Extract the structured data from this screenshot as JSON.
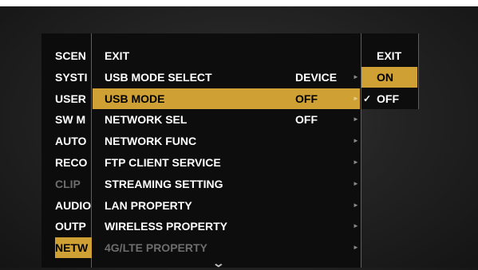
{
  "left_menu": [
    {
      "label": "SCEN",
      "selected": false,
      "disabled": false
    },
    {
      "label": "SYSTI",
      "selected": false,
      "disabled": false
    },
    {
      "label": "USER",
      "selected": false,
      "disabled": false
    },
    {
      "label": "SW M",
      "selected": false,
      "disabled": false
    },
    {
      "label": "AUTO",
      "selected": false,
      "disabled": false
    },
    {
      "label": "RECO",
      "selected": false,
      "disabled": false
    },
    {
      "label": "CLIP",
      "selected": false,
      "disabled": true
    },
    {
      "label": "AUDIO",
      "selected": false,
      "disabled": false
    },
    {
      "label": "OUTP",
      "selected": false,
      "disabled": false
    },
    {
      "label": "NETW",
      "selected": true,
      "disabled": false
    }
  ],
  "network_menu": [
    {
      "label": "EXIT",
      "value": "",
      "has_arrow": false,
      "selected": false,
      "disabled": false
    },
    {
      "label": "USB MODE SELECT",
      "value": "DEVICE",
      "has_arrow": true,
      "selected": false,
      "disabled": false
    },
    {
      "label": "USB MODE",
      "value": "OFF",
      "has_arrow": true,
      "selected": true,
      "disabled": false
    },
    {
      "label": "NETWORK SEL",
      "value": "OFF",
      "has_arrow": true,
      "selected": false,
      "disabled": false
    },
    {
      "label": "NETWORK FUNC",
      "value": "",
      "has_arrow": true,
      "selected": false,
      "disabled": false
    },
    {
      "label": "FTP CLIENT SERVICE",
      "value": "",
      "has_arrow": true,
      "selected": false,
      "disabled": false
    },
    {
      "label": "STREAMING SETTING",
      "value": "",
      "has_arrow": true,
      "selected": false,
      "disabled": false
    },
    {
      "label": "LAN PROPERTY",
      "value": "",
      "has_arrow": true,
      "selected": false,
      "disabled": false
    },
    {
      "label": "WIRELESS PROPERTY",
      "value": "",
      "has_arrow": true,
      "selected": false,
      "disabled": false
    },
    {
      "label": "4G/LTE PROPERTY",
      "value": "",
      "has_arrow": true,
      "selected": false,
      "disabled": true
    }
  ],
  "options_menu": [
    {
      "label": "EXIT",
      "checked": false,
      "selected": false
    },
    {
      "label": "ON",
      "checked": false,
      "selected": true
    },
    {
      "label": "OFF",
      "checked": true,
      "selected": false
    }
  ],
  "arrow_glyph": "►",
  "check_glyph": "✓",
  "more_glyph": "⌄",
  "colors": {
    "highlight": "#cfa033",
    "text": "#ffffff",
    "disabled": "#6d6d6d",
    "background": "#0c0c0c"
  }
}
